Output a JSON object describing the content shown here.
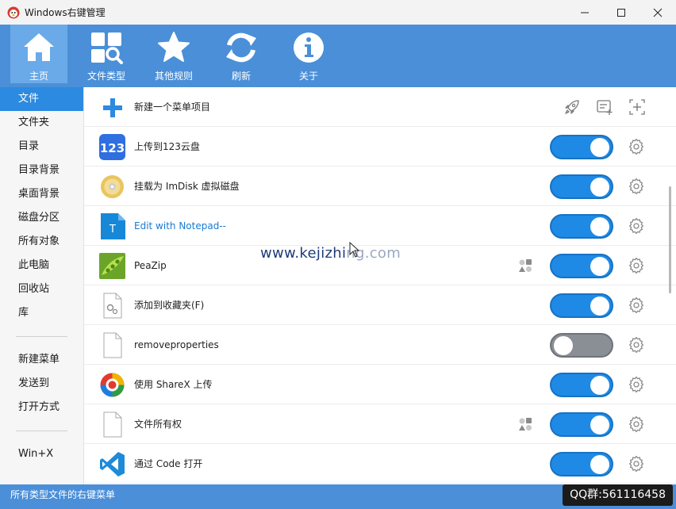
{
  "window": {
    "title": "Windows右键管理"
  },
  "toolbar": {
    "items": [
      {
        "label": "主页",
        "icon": "home-icon",
        "active": true
      },
      {
        "label": "文件类型",
        "icon": "file-types-icon"
      },
      {
        "label": "其他规则",
        "icon": "star-icon"
      },
      {
        "label": "刷新",
        "icon": "refresh-icon"
      },
      {
        "label": "关于",
        "icon": "info-icon"
      }
    ]
  },
  "sidebar": {
    "items": [
      {
        "label": "文件",
        "active": true
      },
      {
        "label": "文件夹"
      },
      {
        "label": "目录"
      },
      {
        "label": "目录背景"
      },
      {
        "label": "桌面背景"
      },
      {
        "label": "磁盘分区"
      },
      {
        "label": "所有对象"
      },
      {
        "label": "此电脑"
      },
      {
        "label": "回收站"
      },
      {
        "label": "库"
      }
    ],
    "group2": [
      {
        "label": "新建菜单"
      },
      {
        "label": "发送到"
      },
      {
        "label": "打开方式"
      }
    ],
    "group3": [
      {
        "label": "Win+X"
      }
    ]
  },
  "main": {
    "new_item": "新建一个菜单项目",
    "rows": [
      {
        "label": "上传到123云盘",
        "icon": "123pan-icon",
        "enabled": true
      },
      {
        "label": "挂载为 ImDisk 虚拟磁盘",
        "icon": "disc-icon",
        "enabled": true
      },
      {
        "label": "Edit with Notepad--",
        "icon": "notepad-icon",
        "enabled": true
      },
      {
        "label": "PeaZip",
        "icon": "peazip-icon",
        "enabled": true
      },
      {
        "label": "添加到收藏夹(F)",
        "icon": "generic-settings-file-icon",
        "enabled": true
      },
      {
        "label": "removeproperties",
        "icon": "blank-file-icon",
        "enabled": false
      },
      {
        "label": "使用 ShareX 上传",
        "icon": "sharex-icon",
        "enabled": true
      },
      {
        "label": "文件所有权",
        "icon": "blank-file-icon",
        "enabled": true
      },
      {
        "label": "通过 Code 打开",
        "icon": "vscode-icon",
        "enabled": true
      }
    ]
  },
  "statusbar": {
    "text": "所有类型文件的右键菜单"
  },
  "overlay": {
    "qq": "QQ群:561116458",
    "watermark_main": "www.kejizhi",
    "watermark_faded": "ng.com"
  },
  "colors": {
    "accent": "#4a8fd8",
    "toggle_on": "#1e8ae6",
    "toggle_off": "#8a8f96"
  }
}
